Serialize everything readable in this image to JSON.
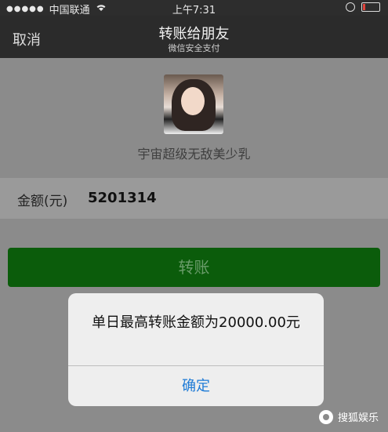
{
  "status_bar": {
    "carrier": "中国联通",
    "time": "上午7:31",
    "battery_color": "#e0433b"
  },
  "nav": {
    "cancel": "取消",
    "title": "转账给朋友",
    "subtitle": "微信安全支付"
  },
  "recipient": {
    "name": "宇宙超级无敌美少乳"
  },
  "amount": {
    "label": "金额(元)",
    "value": "5201314"
  },
  "transfer_button": {
    "label": "转账"
  },
  "alert": {
    "message": "单日最高转账金额为20000.00元",
    "ok": "确定"
  },
  "watermark": {
    "text": "搜狐娱乐"
  },
  "colors": {
    "nav_bg": "#2b2b2b",
    "button_bg": "#0b5c0b",
    "alert_ok": "#1e7bd6"
  }
}
